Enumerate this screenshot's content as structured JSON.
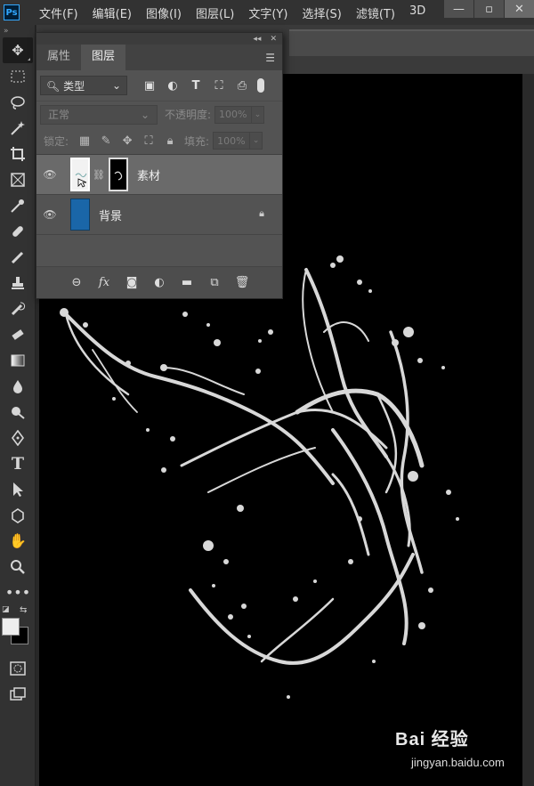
{
  "app_logo": "Ps",
  "menu": [
    "文件(F)",
    "编辑(E)",
    "图像(I)",
    "图层(L)",
    "文字(Y)",
    "选择(S)",
    "滤镜(T)",
    "3D"
  ],
  "window_controls": [
    "—",
    "▫",
    "✕"
  ],
  "toolbar": {
    "collapse": "»",
    "tools": [
      "move-tool",
      "marquee-tool",
      "lasso-tool",
      "magic-wand-tool",
      "crop-tool",
      "frame-tool",
      "eyedropper-tool",
      "healing-brush-tool",
      "brush-tool",
      "clone-stamp-tool",
      "history-brush-tool",
      "eraser-tool",
      "gradient-tool",
      "blur-tool",
      "dodge-tool",
      "pen-tool",
      "type-tool",
      "path-selection-tool",
      "shape-tool",
      "hand-tool",
      "zoom-tool",
      "more-tools"
    ],
    "foreground_color": "#eeeeee",
    "background_color": "#000000"
  },
  "panel": {
    "header_collapse": "◂◂",
    "header_close": "✕",
    "tabs": [
      "属性",
      "图层"
    ],
    "active_tab": "图层",
    "filter": {
      "kind_label": "类型"
    },
    "blend": {
      "mode": "正常",
      "opacity_label": "不透明度:",
      "opacity_value": "100%"
    },
    "lock": {
      "label": "锁定:",
      "fill_label": "填充:",
      "fill_value": "100%"
    },
    "layers": [
      {
        "name": "素材",
        "selected": true,
        "has_mask": true
      },
      {
        "name": "背景",
        "selected": false,
        "locked": true,
        "thumb_color": "#1a66a8"
      }
    ],
    "footer_icons": [
      "link-icon",
      "fx-icon",
      "mask-icon",
      "adjustment-icon",
      "folder-icon",
      "new-layer-icon",
      "trash-icon"
    ]
  },
  "watermark": {
    "logo": "Bai 经验",
    "url": "jingyan.baidu.com"
  }
}
